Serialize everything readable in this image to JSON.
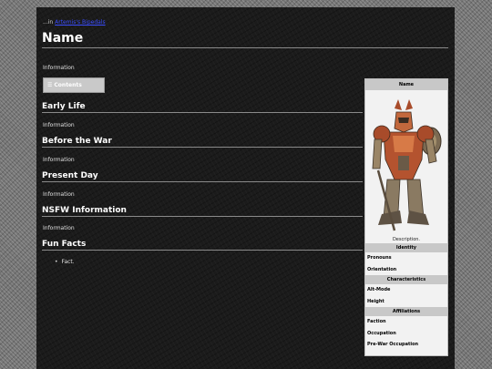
{
  "breadcrumb": {
    "prefix": "...in",
    "link": "Artemis's Bipedals"
  },
  "page_title": "Name",
  "intro_text": "Information",
  "toc_label": "Contents",
  "sections": [
    {
      "heading": "Early Life",
      "text": "Information"
    },
    {
      "heading": "Before the War",
      "text": "Information"
    },
    {
      "heading": "Present Day",
      "text": "Information"
    },
    {
      "heading": "NSFW Information",
      "text": "Information"
    },
    {
      "heading": "Fun Facts",
      "text": ""
    }
  ],
  "fun_facts": [
    "Fact."
  ],
  "infobox": {
    "title": "Name",
    "caption": "Description.",
    "groups": [
      {
        "header": "Identity",
        "rows": [
          "Pronouns",
          "Orientation"
        ]
      },
      {
        "header": "Characteristics",
        "rows": [
          "Alt-Mode",
          "Height"
        ]
      },
      {
        "header": "Affiliations",
        "rows": [
          "Faction",
          "Occupation",
          "Pre-War Occupation"
        ]
      }
    ]
  }
}
